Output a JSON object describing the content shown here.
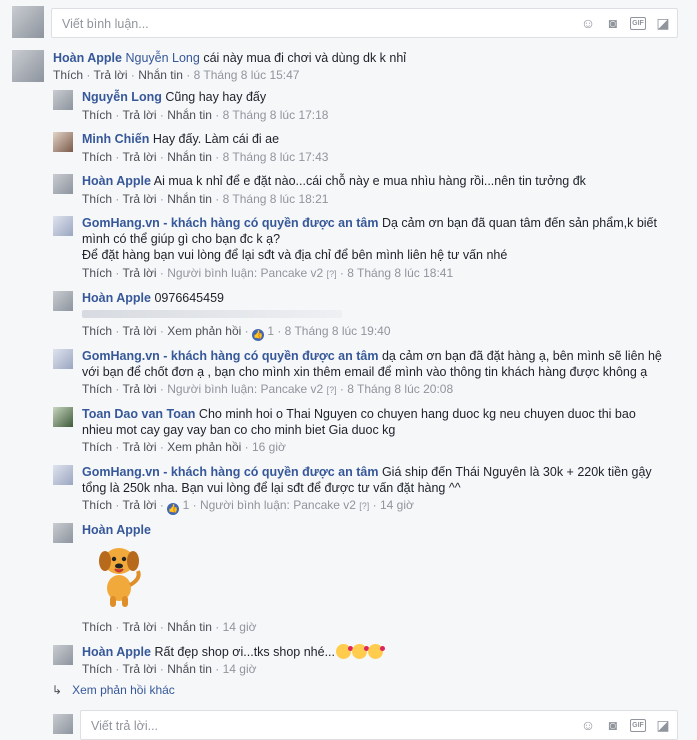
{
  "top_box": {
    "placeholder": "Viết bình luận..."
  },
  "reply_box": {
    "placeholder": "Viết trả lời..."
  },
  "actions": {
    "like": "Thích",
    "reply": "Trả lời",
    "message": "Nhắn tin",
    "see_reply": "Xem phản hồi"
  },
  "comments": [
    {
      "author": "Hoàn Apple",
      "mention": "Nguyễn Long",
      "text": " cái này mua đi chơi và dùng dk k nhỉ",
      "time": "8 Tháng 8 lúc 15:47"
    },
    {
      "author": "Nguyễn Long",
      "text": "Cũng hay hay đấy",
      "time": "8 Tháng 8 lúc 17:18"
    },
    {
      "author": "Minh Chiến",
      "text": "Hay đấy. Làm cái đi ae",
      "time": "8 Tháng 8 lúc 17:43"
    },
    {
      "author": "Hoàn Apple",
      "text": "Ai mua k nhỉ để e đặt nào...cái chỗ này e mua nhìu hàng rồi...nên tin tưởng đk",
      "time": "8 Tháng 8 lúc 18:21"
    },
    {
      "author": "GomHang.vn - khách hàng có quyền được an tâm",
      "text1": " Dạ cảm ơn bạn đã quan tâm đến sản phẩm,k biết",
      "text2": "mình có thể giúp gì cho bạn đc k ạ?",
      "text3": "Để đặt hàng bạn vui lòng để lại sđt và địa chỉ để bên mình liên hệ tư vấn nhé",
      "commenter": "Người bình luận: Pancake v2",
      "qmark": "[?]",
      "time": "8 Tháng 8 lúc 18:41"
    },
    {
      "author": "Hoàn Apple",
      "phone": "0976645459",
      "like_count": "1",
      "time": "8 Tháng 8 lúc 19:40"
    },
    {
      "author": "GomHang.vn - khách hàng có quyền được an tâm",
      "text1": " dạ cảm ơn bạn đã đặt hàng ạ, bên mình sẽ liên hệ",
      "text2": "với bạn để chốt đơn ạ , bạn cho mình xin thêm email để mình vào thông tin khách hàng được không ạ",
      "commenter": "Người bình luận: Pancake v2",
      "qmark": "[?]",
      "time": "8 Tháng 8 lúc 20:08"
    },
    {
      "author": "Toan Dao van Toan",
      "text1": " Cho minh hoi o Thai Nguyen co chuyen hang duoc kg neu chuyen duoc thi bao",
      "text2": "nhieu mot cay gay vay ban co cho minh biet Gia duoc kg",
      "time": "16 giờ"
    },
    {
      "author": "GomHang.vn - khách hàng có quyền được an tâm",
      "text1": " Giá ship đến Thái Nguyên là 30k + 220k tiền gậy",
      "text2": "tổng là 250k nha. Bạn vui lòng để lại sđt để được tư vấn đặt hàng ^^",
      "like_count": "1",
      "commenter": "Người bình luận: Pancake v2",
      "qmark": "[?]",
      "time": "14 giờ"
    },
    {
      "author": "Hoàn Apple",
      "time": "14 giờ"
    },
    {
      "author": "Hoàn Apple",
      "text": "Rất đẹp shop ơi...tks shop nhé...",
      "time": "14 giờ"
    }
  ],
  "more_replies": "Xem phản hồi khác",
  "icons": [
    "smiley-icon",
    "camera-icon",
    "gif-icon",
    "sticker-icon"
  ],
  "colors": {
    "link": "#365899",
    "meta": "#90949c",
    "background": "#f6f7f9"
  }
}
